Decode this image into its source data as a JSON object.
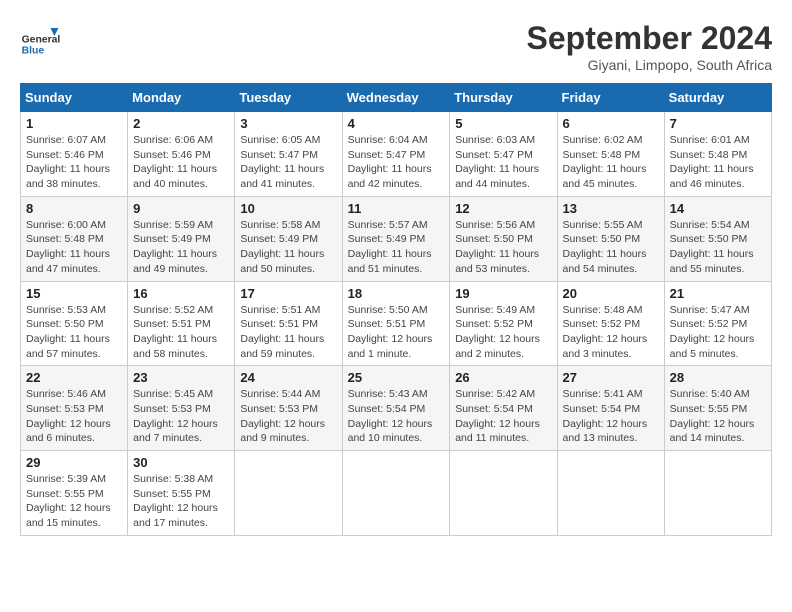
{
  "header": {
    "logo_general": "General",
    "logo_blue": "Blue",
    "month_title": "September 2024",
    "location": "Giyani, Limpopo, South Africa"
  },
  "weekdays": [
    "Sunday",
    "Monday",
    "Tuesday",
    "Wednesday",
    "Thursday",
    "Friday",
    "Saturday"
  ],
  "weeks": [
    [
      {
        "day": "1",
        "sunrise": "6:07 AM",
        "sunset": "5:46 PM",
        "daylight": "11 hours and 38 minutes."
      },
      {
        "day": "2",
        "sunrise": "6:06 AM",
        "sunset": "5:46 PM",
        "daylight": "11 hours and 40 minutes."
      },
      {
        "day": "3",
        "sunrise": "6:05 AM",
        "sunset": "5:47 PM",
        "daylight": "11 hours and 41 minutes."
      },
      {
        "day": "4",
        "sunrise": "6:04 AM",
        "sunset": "5:47 PM",
        "daylight": "11 hours and 42 minutes."
      },
      {
        "day": "5",
        "sunrise": "6:03 AM",
        "sunset": "5:47 PM",
        "daylight": "11 hours and 44 minutes."
      },
      {
        "day": "6",
        "sunrise": "6:02 AM",
        "sunset": "5:48 PM",
        "daylight": "11 hours and 45 minutes."
      },
      {
        "day": "7",
        "sunrise": "6:01 AM",
        "sunset": "5:48 PM",
        "daylight": "11 hours and 46 minutes."
      }
    ],
    [
      {
        "day": "8",
        "sunrise": "6:00 AM",
        "sunset": "5:48 PM",
        "daylight": "11 hours and 47 minutes."
      },
      {
        "day": "9",
        "sunrise": "5:59 AM",
        "sunset": "5:49 PM",
        "daylight": "11 hours and 49 minutes."
      },
      {
        "day": "10",
        "sunrise": "5:58 AM",
        "sunset": "5:49 PM",
        "daylight": "11 hours and 50 minutes."
      },
      {
        "day": "11",
        "sunrise": "5:57 AM",
        "sunset": "5:49 PM",
        "daylight": "11 hours and 51 minutes."
      },
      {
        "day": "12",
        "sunrise": "5:56 AM",
        "sunset": "5:50 PM",
        "daylight": "11 hours and 53 minutes."
      },
      {
        "day": "13",
        "sunrise": "5:55 AM",
        "sunset": "5:50 PM",
        "daylight": "11 hours and 54 minutes."
      },
      {
        "day": "14",
        "sunrise": "5:54 AM",
        "sunset": "5:50 PM",
        "daylight": "11 hours and 55 minutes."
      }
    ],
    [
      {
        "day": "15",
        "sunrise": "5:53 AM",
        "sunset": "5:50 PM",
        "daylight": "11 hours and 57 minutes."
      },
      {
        "day": "16",
        "sunrise": "5:52 AM",
        "sunset": "5:51 PM",
        "daylight": "11 hours and 58 minutes."
      },
      {
        "day": "17",
        "sunrise": "5:51 AM",
        "sunset": "5:51 PM",
        "daylight": "11 hours and 59 minutes."
      },
      {
        "day": "18",
        "sunrise": "5:50 AM",
        "sunset": "5:51 PM",
        "daylight": "12 hours and 1 minute."
      },
      {
        "day": "19",
        "sunrise": "5:49 AM",
        "sunset": "5:52 PM",
        "daylight": "12 hours and 2 minutes."
      },
      {
        "day": "20",
        "sunrise": "5:48 AM",
        "sunset": "5:52 PM",
        "daylight": "12 hours and 3 minutes."
      },
      {
        "day": "21",
        "sunrise": "5:47 AM",
        "sunset": "5:52 PM",
        "daylight": "12 hours and 5 minutes."
      }
    ],
    [
      {
        "day": "22",
        "sunrise": "5:46 AM",
        "sunset": "5:53 PM",
        "daylight": "12 hours and 6 minutes."
      },
      {
        "day": "23",
        "sunrise": "5:45 AM",
        "sunset": "5:53 PM",
        "daylight": "12 hours and 7 minutes."
      },
      {
        "day": "24",
        "sunrise": "5:44 AM",
        "sunset": "5:53 PM",
        "daylight": "12 hours and 9 minutes."
      },
      {
        "day": "25",
        "sunrise": "5:43 AM",
        "sunset": "5:54 PM",
        "daylight": "12 hours and 10 minutes."
      },
      {
        "day": "26",
        "sunrise": "5:42 AM",
        "sunset": "5:54 PM",
        "daylight": "12 hours and 11 minutes."
      },
      {
        "day": "27",
        "sunrise": "5:41 AM",
        "sunset": "5:54 PM",
        "daylight": "12 hours and 13 minutes."
      },
      {
        "day": "28",
        "sunrise": "5:40 AM",
        "sunset": "5:55 PM",
        "daylight": "12 hours and 14 minutes."
      }
    ],
    [
      {
        "day": "29",
        "sunrise": "5:39 AM",
        "sunset": "5:55 PM",
        "daylight": "12 hours and 15 minutes."
      },
      {
        "day": "30",
        "sunrise": "5:38 AM",
        "sunset": "5:55 PM",
        "daylight": "12 hours and 17 minutes."
      },
      null,
      null,
      null,
      null,
      null
    ]
  ],
  "labels": {
    "sunrise": "Sunrise: ",
    "sunset": "Sunset: ",
    "daylight": "Daylight: "
  }
}
